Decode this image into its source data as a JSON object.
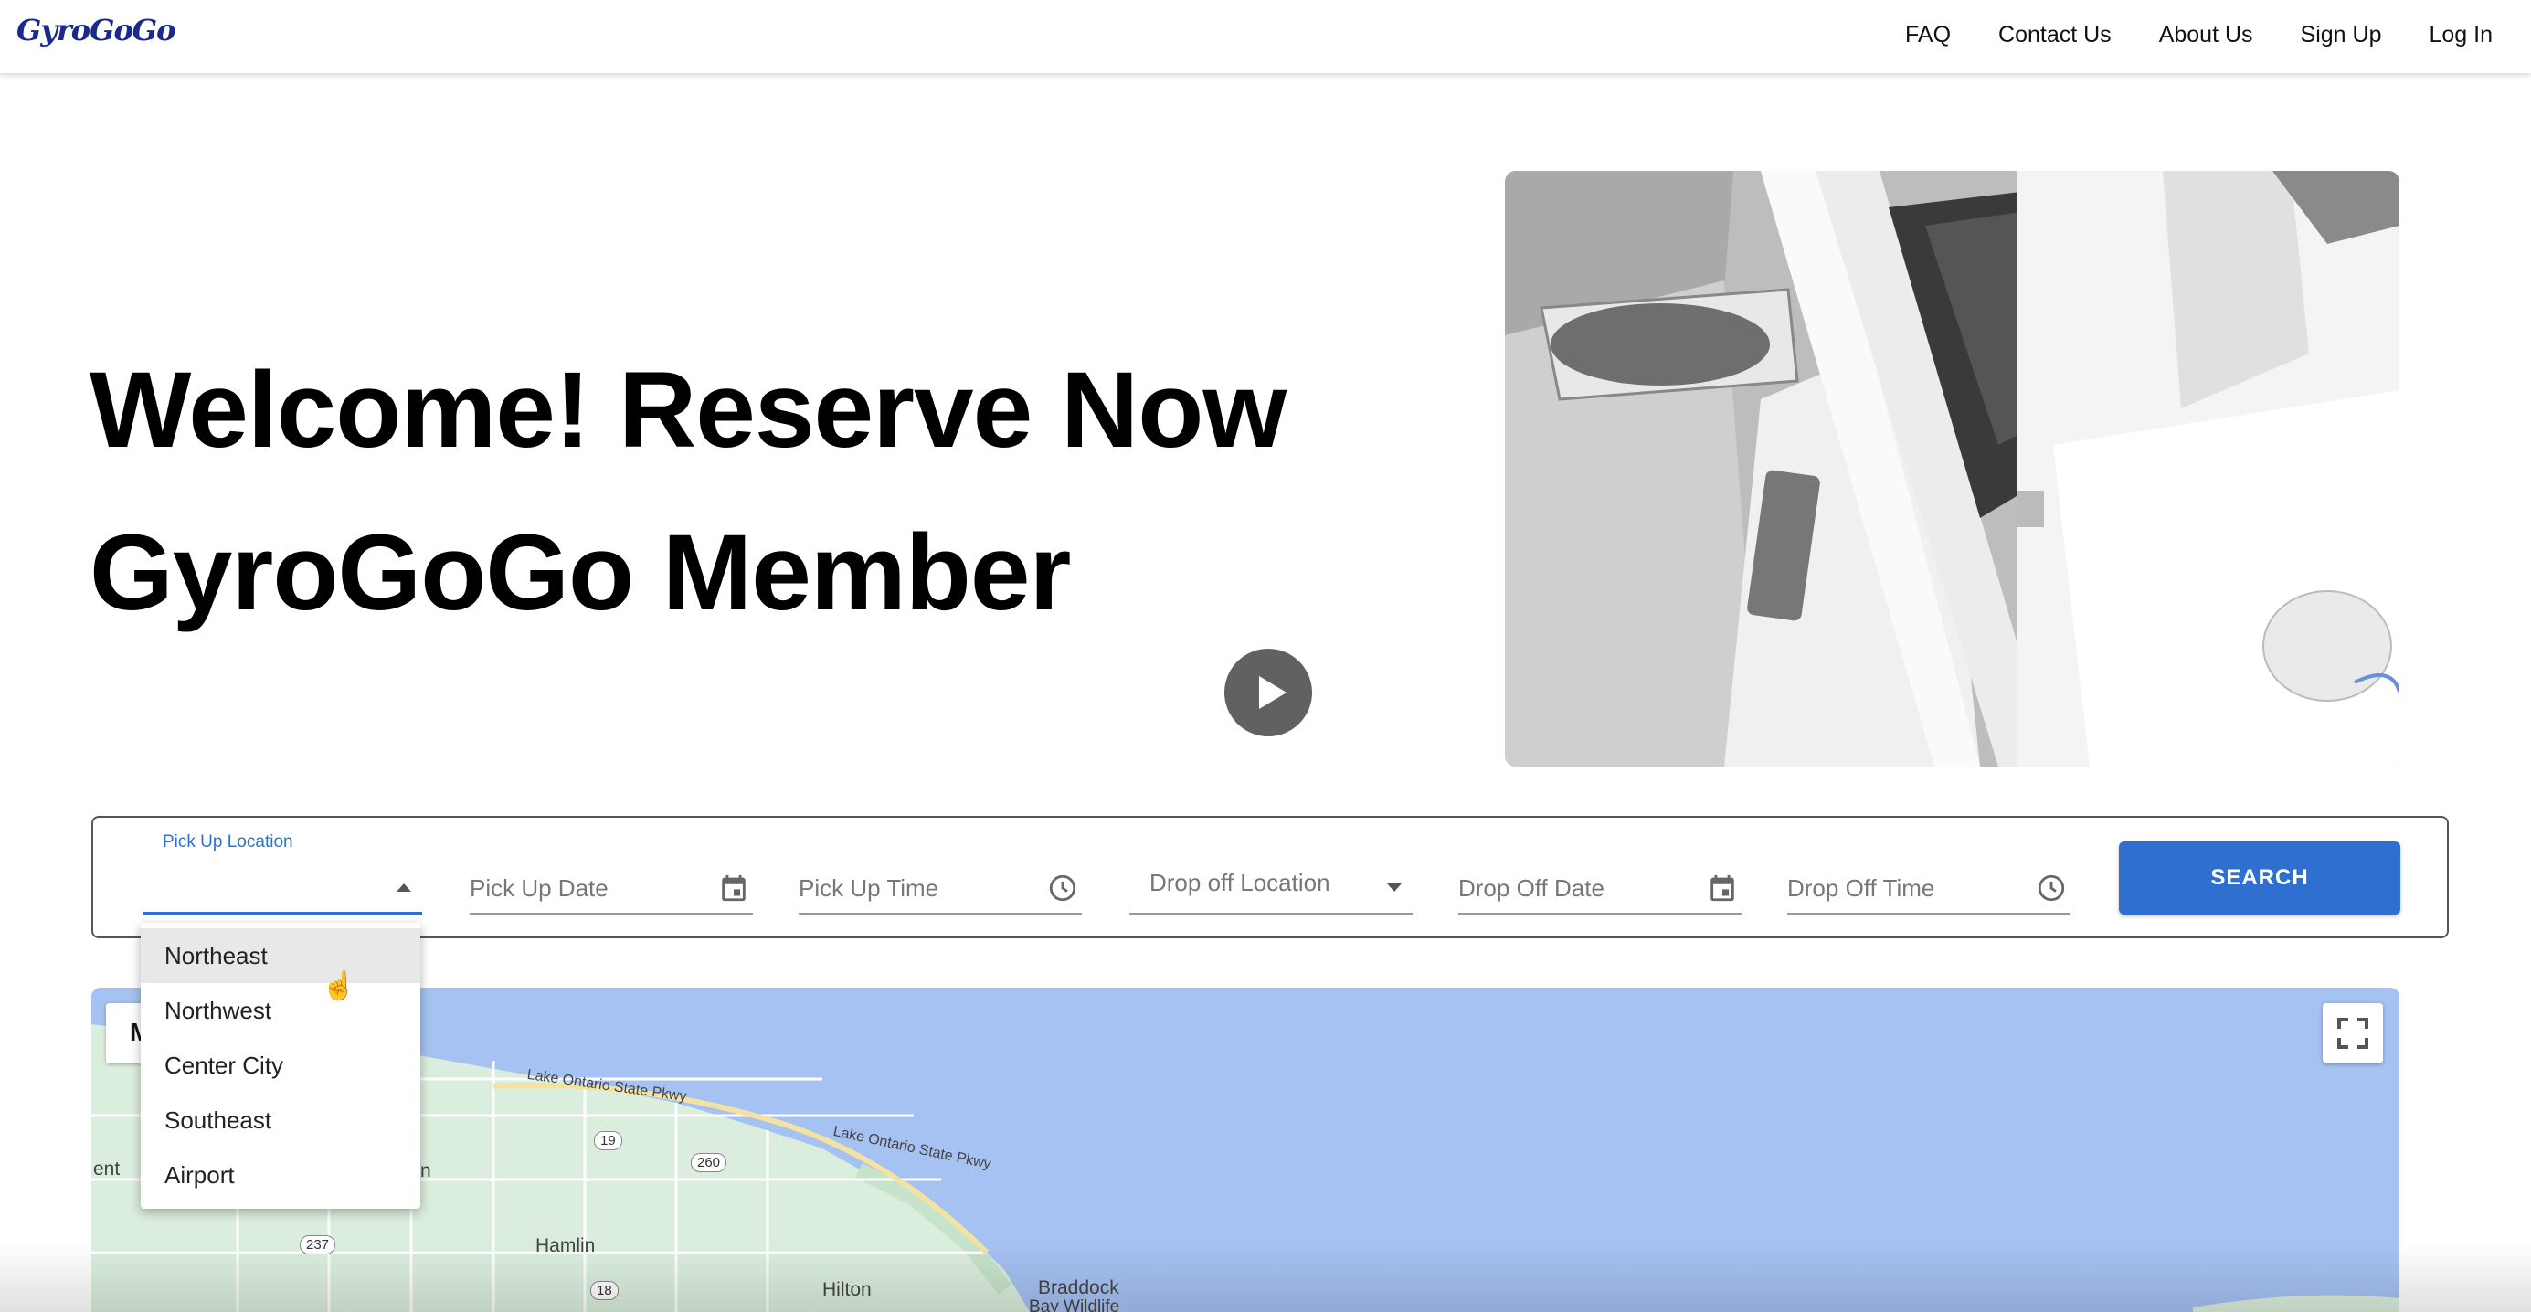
{
  "header": {
    "logo": "GyroGoGo",
    "nav": [
      "FAQ",
      "Contact Us",
      "About Us",
      "Sign Up",
      "Log In"
    ]
  },
  "hero": {
    "title_line1": "Welcome! Reserve Now",
    "title_line2": "GyroGoGo Member"
  },
  "search": {
    "pickup_location_label": "Pick Up Location",
    "pickup_date_placeholder": "Pick Up Date",
    "pickup_time_placeholder": "Pick Up Time",
    "dropoff_location_placeholder": "Drop off Location",
    "dropoff_date_placeholder": "Drop Off Date",
    "dropoff_time_placeholder": "Drop Off Time",
    "search_button": "SEARCH",
    "location_options": [
      "Northeast",
      "Northwest",
      "Center City",
      "Southeast",
      "Airport"
    ],
    "hovered_option": "Northeast"
  },
  "map": {
    "type_button_letter": "M",
    "labels": {
      "pkwy1": "Lake Ontario State Pkwy",
      "pkwy2": "Lake Ontario State Pkwy",
      "hamlin": "Hamlin",
      "hilton": "Hilton",
      "braddock": "Braddock",
      "braddock2": "Bay Wildlife",
      "ent": "ent",
      "n": "n"
    },
    "road_badges": {
      "r19": "19",
      "r260": "260",
      "r237": "237",
      "r18": "18"
    }
  },
  "colors": {
    "accent": "#2f6fd0",
    "map_water": "#a5c2f2",
    "map_land": "#dbeedd"
  }
}
